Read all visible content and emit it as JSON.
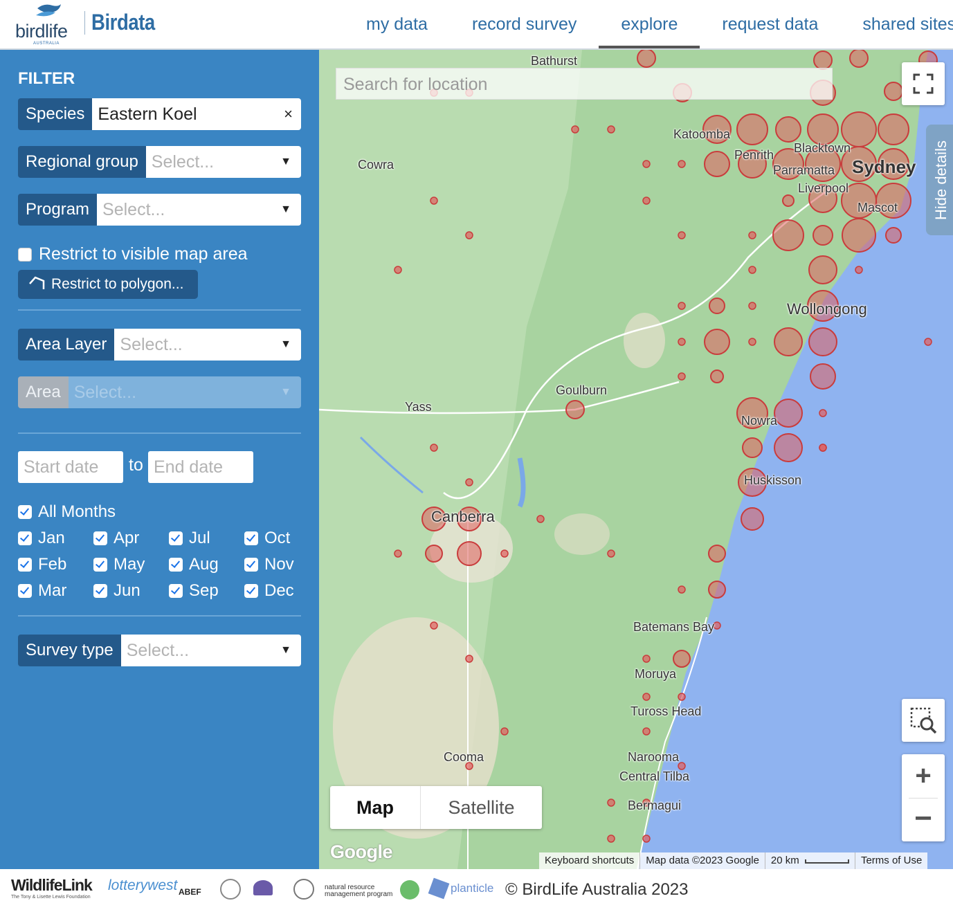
{
  "header": {
    "logo_text": "birdlife",
    "logo_sub": "AUSTRALIA",
    "app_name": "Birdata",
    "nav": [
      "my data",
      "record survey",
      "explore",
      "request data",
      "shared sites"
    ],
    "active_nav": "explore"
  },
  "filter": {
    "title": "FILTER",
    "species": {
      "label": "Species",
      "value": "Eastern Koel"
    },
    "regional_group": {
      "label": "Regional group",
      "placeholder": "Select..."
    },
    "program": {
      "label": "Program",
      "placeholder": "Select..."
    },
    "restrict_visible": "Restrict to visible map area",
    "restrict_polygon": "Restrict to polygon...",
    "area_layer": {
      "label": "Area Layer",
      "placeholder": "Select..."
    },
    "area": {
      "label": "Area",
      "placeholder": "Select..."
    },
    "start_date": "Start date",
    "to": "to",
    "end_date": "End date",
    "all_months": "All Months",
    "months": [
      "Jan",
      "Apr",
      "Jul",
      "Oct",
      "Feb",
      "May",
      "Aug",
      "Nov",
      "Mar",
      "Jun",
      "Sep",
      "Dec"
    ],
    "survey_type": {
      "label": "Survey type",
      "placeholder": "Select..."
    }
  },
  "map": {
    "search_placeholder": "Search for location",
    "hide_details": "Hide details",
    "map_type": [
      "Map",
      "Satellite"
    ],
    "active_map_type": "Map",
    "google": "Google",
    "attribution": [
      "Keyboard shortcuts",
      "Map data ©2023 Google",
      "20 km",
      "Terms of Use"
    ],
    "places": [
      "Bathurst",
      "Katoomba",
      "Penrith",
      "Blacktown",
      "Parramatta",
      "Sydney",
      "Liverpool",
      "Mascot",
      "Cowra",
      "Wollongong",
      "Goulburn",
      "Yass",
      "Nowra",
      "Huskisson",
      "Canberra",
      "Batemans Bay",
      "Moruya",
      "Tuross Head",
      "Cooma",
      "Narooma",
      "Central Tilba",
      "Bermagui"
    ],
    "colors": {
      "land": "#a9d4a0",
      "sea": "#8fb3f0",
      "marker": "#e06060"
    }
  },
  "footer": {
    "sponsors": [
      "WildlifeLink",
      "The Tony & Lisette Lewis Foundation",
      "lotterywest",
      "ABEF",
      "natural resource management program",
      "planticle"
    ],
    "copyright": "© BirdLife Australia 2023"
  }
}
